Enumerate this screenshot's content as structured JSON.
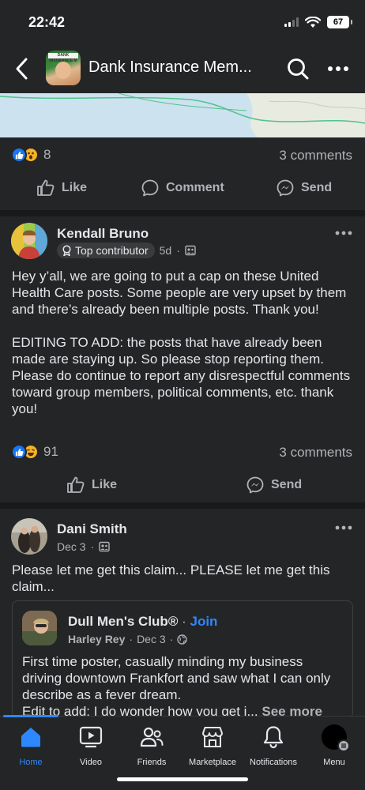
{
  "status_bar": {
    "time": "22:42",
    "battery": "67"
  },
  "header": {
    "title": "Dank Insurance Mem...",
    "group_avatar_text": "DANK INSURANCE M"
  },
  "post1": {
    "reaction_count": "8",
    "comments": "3 comments",
    "actions": {
      "like": "Like",
      "comment": "Comment",
      "send": "Send"
    }
  },
  "post2": {
    "author": "Kendall Bruno",
    "badge": "Top contributor",
    "time": "5d",
    "text_p1": "Hey y’all, we are going to put a cap on these United Health Care posts. Some people are very upset by them and there’s already been multiple posts. Thank you!",
    "text_p2": "EDITING TO ADD: the posts that have already been made are staying up. So please stop reporting them. Please do continue to report any disrespectful comments toward group members, political comments, etc. thank you!",
    "reaction_count": "91",
    "comments": "3 comments",
    "actions": {
      "like": "Like",
      "send": "Send"
    }
  },
  "post3": {
    "author": "Dani Smith",
    "time": "Dec 3",
    "text": "Please let me get this claim... PLEASE let me get this claim...",
    "shared": {
      "group": "Dull Men's Club®",
      "join": "Join",
      "author": "Harley Rey",
      "time": "Dec 3",
      "text": "First time poster, casually minding my business driving downtown Frankfort and saw what I can only describe as a fever dream.",
      "text_line4": "Edit to add: I do wonder how you get i...",
      "see_more": "See more"
    }
  },
  "bottom_nav": {
    "items": [
      {
        "label": "Home",
        "icon": "home-icon"
      },
      {
        "label": "Video",
        "icon": "video-icon"
      },
      {
        "label": "Friends",
        "icon": "friends-icon"
      },
      {
        "label": "Marketplace",
        "icon": "marketplace-icon"
      },
      {
        "label": "Notifications",
        "icon": "bell-icon"
      },
      {
        "label": "Menu",
        "icon": "profile-avatar"
      }
    ],
    "active_color": "#2d88ff"
  },
  "colors": {
    "background": "#242526",
    "separator": "#18191a",
    "text": "#e4e6eb",
    "muted": "#b0b3b8",
    "accent": "#2d88ff"
  }
}
